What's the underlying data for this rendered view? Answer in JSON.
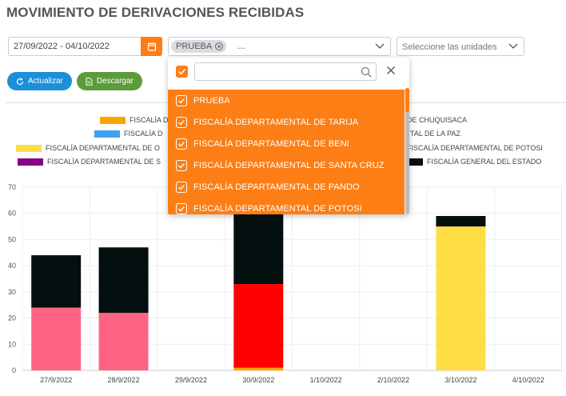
{
  "title": "MOVIMIENTO DE DERIVACIONES RECIBIDAS",
  "filters": {
    "date_range": "27/09/2022 - 04/10/2022",
    "calendar_icon": "calendar-icon",
    "selected_tag": "PRUEBA",
    "more": "...",
    "units_placeholder": "Seleccione las unidades"
  },
  "buttons": {
    "actualizar": "Actualizar",
    "descargar": "Descargar"
  },
  "dropdown": {
    "search_value": "",
    "items": [
      "PRUEBA",
      "FISCALÍA DEPARTAMENTAL DE TARIJA",
      "FISCALÍA DEPARTAMENTAL DE BENI",
      "FISCALÍA DEPARTAMENTAL DE SANTA CRUZ",
      "FISCALÍA DEPARTAMENTAL DE PANDO",
      "FISCALÍA DEPARTAMENTAL DE POTOSI"
    ]
  },
  "legend": [
    {
      "label": "FISCALÍA D",
      "color": "#f7a600"
    },
    {
      "label": "DE CHUQUISACA",
      "color": "#ffffff"
    },
    {
      "label": "FISCALÍA D",
      "color": "#40a0f0"
    },
    {
      "label": "TAL DE LA PAZ",
      "color": "#ffffff"
    },
    {
      "label": "FISCALÍA DEPARTAMENTAL DE O",
      "color": "#ffdd44"
    },
    {
      "label": "FISCALÍA DEPARTAMENTAL DE POTOSI",
      "color": "#ffffff"
    },
    {
      "label": "FISCALÍA DEPARTAMENTAL DE S",
      "color": "#880088"
    },
    {
      "label": "FISCALÍA GENERAL DEL ESTADO",
      "color": "#040f0f"
    }
  ],
  "chart_data": {
    "type": "bar",
    "stacked": true,
    "categories": [
      "27/9/2022",
      "28/9/2022",
      "29/9/2022",
      "30/9/2022",
      "1/10/2022",
      "2/10/2022",
      "3/10/2022",
      "4/10/2022"
    ],
    "y_ticks": [
      0,
      10,
      20,
      30,
      40,
      50,
      60,
      70
    ],
    "ylim": [
      0,
      70
    ],
    "grid": true,
    "series": [
      {
        "color": "#f7a600",
        "values": [
          0,
          0,
          0,
          1,
          0,
          0,
          0,
          0
        ]
      },
      {
        "color": "#ff0000",
        "values": [
          0,
          0,
          0,
          32,
          0,
          0,
          0,
          0
        ]
      },
      {
        "color": "#ff6384",
        "values": [
          24,
          22,
          0,
          0,
          0,
          0,
          0,
          0
        ]
      },
      {
        "color": "#ffdd44",
        "values": [
          0,
          0,
          0,
          0,
          0,
          0,
          55,
          0
        ]
      },
      {
        "name": "FISCALÍA GENERAL DEL ESTADO",
        "color": "#040f0f",
        "values": [
          20,
          25,
          0,
          36,
          0,
          0,
          4,
          0
        ]
      }
    ]
  }
}
